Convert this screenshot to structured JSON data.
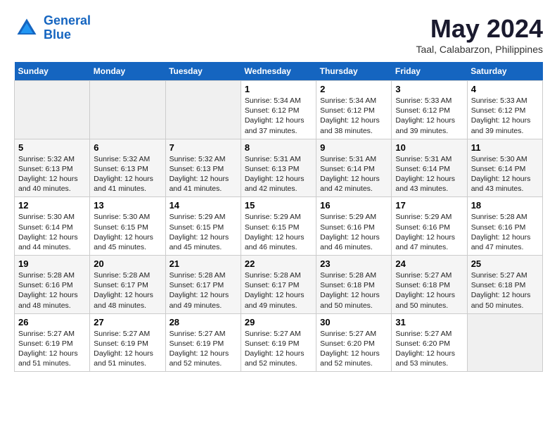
{
  "header": {
    "logo_line1": "General",
    "logo_line2": "Blue",
    "month_title": "May 2024",
    "location": "Taal, Calabarzon, Philippines"
  },
  "weekdays": [
    "Sunday",
    "Monday",
    "Tuesday",
    "Wednesday",
    "Thursday",
    "Friday",
    "Saturday"
  ],
  "weeks": [
    [
      {
        "day": null,
        "sunrise": null,
        "sunset": null,
        "daylight": null
      },
      {
        "day": null,
        "sunrise": null,
        "sunset": null,
        "daylight": null
      },
      {
        "day": null,
        "sunrise": null,
        "sunset": null,
        "daylight": null
      },
      {
        "day": "1",
        "sunrise": "5:34 AM",
        "sunset": "6:12 PM",
        "daylight": "12 hours and 37 minutes."
      },
      {
        "day": "2",
        "sunrise": "5:34 AM",
        "sunset": "6:12 PM",
        "daylight": "12 hours and 38 minutes."
      },
      {
        "day": "3",
        "sunrise": "5:33 AM",
        "sunset": "6:12 PM",
        "daylight": "12 hours and 39 minutes."
      },
      {
        "day": "4",
        "sunrise": "5:33 AM",
        "sunset": "6:12 PM",
        "daylight": "12 hours and 39 minutes."
      }
    ],
    [
      {
        "day": "5",
        "sunrise": "5:32 AM",
        "sunset": "6:13 PM",
        "daylight": "12 hours and 40 minutes."
      },
      {
        "day": "6",
        "sunrise": "5:32 AM",
        "sunset": "6:13 PM",
        "daylight": "12 hours and 41 minutes."
      },
      {
        "day": "7",
        "sunrise": "5:32 AM",
        "sunset": "6:13 PM",
        "daylight": "12 hours and 41 minutes."
      },
      {
        "day": "8",
        "sunrise": "5:31 AM",
        "sunset": "6:13 PM",
        "daylight": "12 hours and 42 minutes."
      },
      {
        "day": "9",
        "sunrise": "5:31 AM",
        "sunset": "6:14 PM",
        "daylight": "12 hours and 42 minutes."
      },
      {
        "day": "10",
        "sunrise": "5:31 AM",
        "sunset": "6:14 PM",
        "daylight": "12 hours and 43 minutes."
      },
      {
        "day": "11",
        "sunrise": "5:30 AM",
        "sunset": "6:14 PM",
        "daylight": "12 hours and 43 minutes."
      }
    ],
    [
      {
        "day": "12",
        "sunrise": "5:30 AM",
        "sunset": "6:14 PM",
        "daylight": "12 hours and 44 minutes."
      },
      {
        "day": "13",
        "sunrise": "5:30 AM",
        "sunset": "6:15 PM",
        "daylight": "12 hours and 45 minutes."
      },
      {
        "day": "14",
        "sunrise": "5:29 AM",
        "sunset": "6:15 PM",
        "daylight": "12 hours and 45 minutes."
      },
      {
        "day": "15",
        "sunrise": "5:29 AM",
        "sunset": "6:15 PM",
        "daylight": "12 hours and 46 minutes."
      },
      {
        "day": "16",
        "sunrise": "5:29 AM",
        "sunset": "6:16 PM",
        "daylight": "12 hours and 46 minutes."
      },
      {
        "day": "17",
        "sunrise": "5:29 AM",
        "sunset": "6:16 PM",
        "daylight": "12 hours and 47 minutes."
      },
      {
        "day": "18",
        "sunrise": "5:28 AM",
        "sunset": "6:16 PM",
        "daylight": "12 hours and 47 minutes."
      }
    ],
    [
      {
        "day": "19",
        "sunrise": "5:28 AM",
        "sunset": "6:16 PM",
        "daylight": "12 hours and 48 minutes."
      },
      {
        "day": "20",
        "sunrise": "5:28 AM",
        "sunset": "6:17 PM",
        "daylight": "12 hours and 48 minutes."
      },
      {
        "day": "21",
        "sunrise": "5:28 AM",
        "sunset": "6:17 PM",
        "daylight": "12 hours and 49 minutes."
      },
      {
        "day": "22",
        "sunrise": "5:28 AM",
        "sunset": "6:17 PM",
        "daylight": "12 hours and 49 minutes."
      },
      {
        "day": "23",
        "sunrise": "5:28 AM",
        "sunset": "6:18 PM",
        "daylight": "12 hours and 50 minutes."
      },
      {
        "day": "24",
        "sunrise": "5:27 AM",
        "sunset": "6:18 PM",
        "daylight": "12 hours and 50 minutes."
      },
      {
        "day": "25",
        "sunrise": "5:27 AM",
        "sunset": "6:18 PM",
        "daylight": "12 hours and 50 minutes."
      }
    ],
    [
      {
        "day": "26",
        "sunrise": "5:27 AM",
        "sunset": "6:19 PM",
        "daylight": "12 hours and 51 minutes."
      },
      {
        "day": "27",
        "sunrise": "5:27 AM",
        "sunset": "6:19 PM",
        "daylight": "12 hours and 51 minutes."
      },
      {
        "day": "28",
        "sunrise": "5:27 AM",
        "sunset": "6:19 PM",
        "daylight": "12 hours and 52 minutes."
      },
      {
        "day": "29",
        "sunrise": "5:27 AM",
        "sunset": "6:19 PM",
        "daylight": "12 hours and 52 minutes."
      },
      {
        "day": "30",
        "sunrise": "5:27 AM",
        "sunset": "6:20 PM",
        "daylight": "12 hours and 52 minutes."
      },
      {
        "day": "31",
        "sunrise": "5:27 AM",
        "sunset": "6:20 PM",
        "daylight": "12 hours and 53 minutes."
      },
      {
        "day": null,
        "sunrise": null,
        "sunset": null,
        "daylight": null
      }
    ]
  ]
}
